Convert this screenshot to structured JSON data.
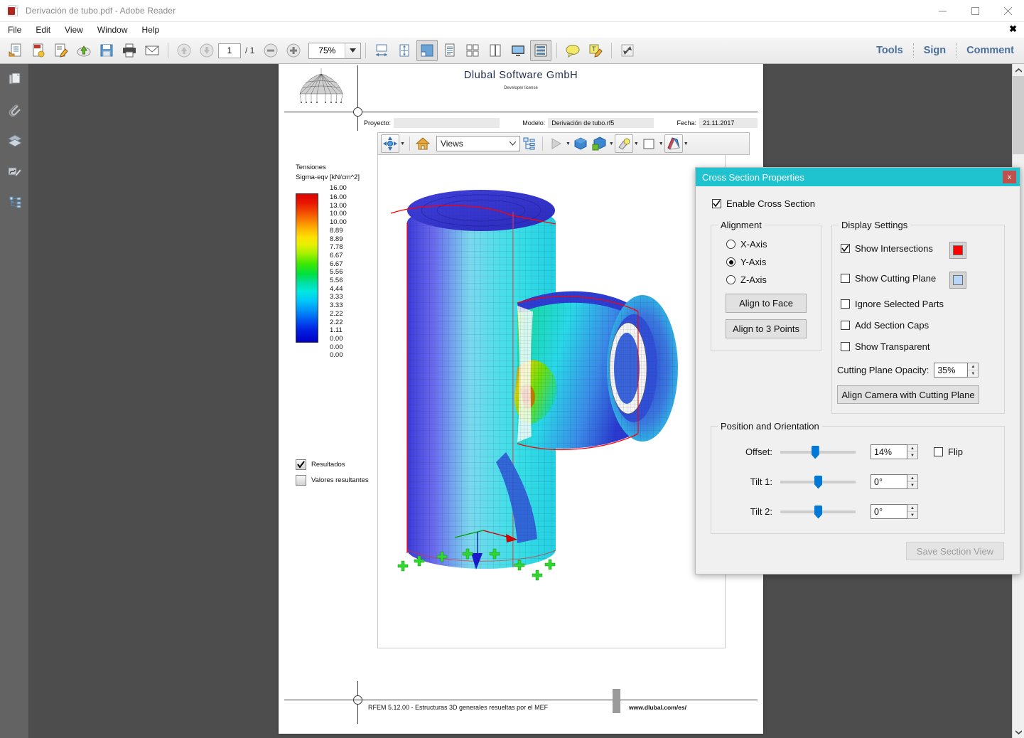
{
  "window": {
    "title": "Derivación de tubo.pdf - Adobe Reader",
    "minimize": "–",
    "maximize": "□",
    "close": "✕"
  },
  "menubar": {
    "items": [
      "File",
      "Edit",
      "View",
      "Window",
      "Help"
    ],
    "close_x": "✖"
  },
  "toolbar": {
    "page_current": "1",
    "page_total": "/ 1",
    "zoom_value": "75%",
    "right_buttons": [
      "Tools",
      "Sign",
      "Comment"
    ],
    "icons": [
      "open-file-icon",
      "create-pdf-icon",
      "edit-pdf-icon",
      "upload-cloud-icon",
      "save-icon",
      "print-icon",
      "email-icon",
      "page-up-icon",
      "page-down-icon",
      "zoom-out-icon",
      "zoom-in-icon",
      "zoom-dropdown-icon",
      "fit-width-icon",
      "fit-page-icon",
      "fit-visible-icon",
      "single-page-icon",
      "two-page-icon",
      "two-page-scrolling-icon",
      "read-mode-icon",
      "scrolling-mode-icon",
      "comment-bubble-icon",
      "highlight-text-icon",
      "fullscreen-icon"
    ]
  },
  "navrail": {
    "items": [
      "page-thumbnails-icon",
      "attachments-icon",
      "layers-icon",
      "signatures-icon",
      "bookmarks-icon"
    ]
  },
  "pdf_page": {
    "company": "Dlubal  Software  GmbH",
    "license": "Developer license",
    "info": {
      "project_label": "Proyecto:",
      "project_value": "",
      "model_label": "Modelo:",
      "model_value": "Derivación de tubo.rf5",
      "date_label": "Fecha:",
      "date_value": "21.11.2017"
    },
    "footer": {
      "text": "RFEM 5.12.00 - Estructuras 3D generales resueltas por el MEF",
      "url": "www.dlubal.com/es/"
    }
  },
  "model_toolbar": {
    "views_value": "Views",
    "buttons": [
      "rotate-tool-icon",
      "home-view-icon",
      "model-tree-icon",
      "play-animation-icon",
      "use-default-render-icon",
      "model-render-mode-icon",
      "lighting-icon",
      "background-color-icon",
      "cross-section-icon"
    ]
  },
  "legend": {
    "title": "Tensiones",
    "subtitle": "Sigma-eqv [kN/cm^2]",
    "max_label": "16.00",
    "values": [
      "16.00",
      "13.00",
      "10.00",
      "10.00",
      "8.89",
      "8.89",
      "7.78",
      "6.67",
      "6.67",
      "5.56",
      "5.56",
      "4.44",
      "3.33",
      "3.33",
      "2.22",
      "2.22",
      "1.11",
      "0.00",
      "0.00",
      "0.00"
    ],
    "checkboxes": [
      {
        "label": "Resultados",
        "checked": true
      },
      {
        "label": "Valores  resultantes",
        "checked": false
      }
    ]
  },
  "dialog": {
    "title": "Cross Section Properties",
    "close_label": "x",
    "enable": {
      "label": "Enable Cross Section",
      "checked": true
    },
    "alignment": {
      "title": "Alignment",
      "options": [
        {
          "label": "X-Axis",
          "selected": false
        },
        {
          "label": "Y-Axis",
          "selected": true
        },
        {
          "label": "Z-Axis",
          "selected": false
        }
      ],
      "buttons": [
        "Align to Face",
        "Align to 3 Points"
      ]
    },
    "display_settings": {
      "title": "Display Settings",
      "checkboxes": [
        {
          "label": "Show Intersections",
          "checked": true,
          "swatch": "#ff0000"
        },
        {
          "label": "Show Cutting Plane",
          "checked": false,
          "swatch": "#b9d5f7"
        },
        {
          "label": "Ignore Selected Parts",
          "checked": false
        },
        {
          "label": "Add Section Caps",
          "checked": false
        },
        {
          "label": "Show Transparent",
          "checked": false
        }
      ],
      "opacity_label": "Cutting Plane Opacity:",
      "opacity_value": "35%",
      "align_camera_button": "Align Camera with Cutting Plane"
    },
    "position": {
      "title": "Position and Orientation",
      "rows": [
        {
          "label": "Offset:",
          "value": "14%",
          "slider_pct": 46
        },
        {
          "label": "Tilt 1:",
          "value": "0°",
          "slider_pct": 50
        },
        {
          "label": "Tilt 2:",
          "value": "0°",
          "slider_pct": 50
        }
      ],
      "flip": {
        "label": "Flip",
        "checked": false
      }
    },
    "save_button": "Save Section View"
  },
  "colors": {
    "dialog_titlebar": "#1fc2cf",
    "dialog_close": "#c0504d",
    "accent_link": "#4a6f9b",
    "slider_thumb": "#0078d7",
    "navrail_bg": "#636363",
    "doc_bg": "#4d4d4d"
  }
}
